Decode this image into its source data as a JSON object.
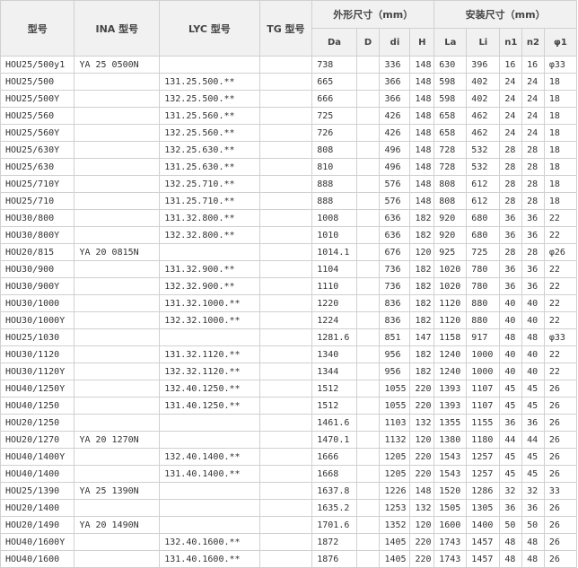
{
  "headers": {
    "model": "型号",
    "ina": "INA 型号",
    "lyc": "LYC 型号",
    "tg": "TG 型号",
    "outer_group": "外形尺寸（mm）",
    "install_group": "安装尺寸（mm）",
    "outer_cols": [
      "Da",
      "D",
      "di",
      "H"
    ],
    "install_cols": [
      "La",
      "Li",
      "n1",
      "n2",
      "φ1"
    ]
  },
  "rows": [
    [
      "HOU25/500y1",
      "YA 25 0500N",
      "",
      "",
      "738",
      "",
      "336",
      "148",
      "630",
      "396",
      "16",
      "16",
      "φ33"
    ],
    [
      "HOU25/500",
      "",
      "131.25.500.**",
      "",
      "665",
      "",
      "366",
      "148",
      "598",
      "402",
      "24",
      "24",
      "18"
    ],
    [
      "HOU25/500Y",
      "",
      "132.25.500.**",
      "",
      "666",
      "",
      "366",
      "148",
      "598",
      "402",
      "24",
      "24",
      "18"
    ],
    [
      "HOU25/560",
      "",
      "131.25.560.**",
      "",
      "725",
      "",
      "426",
      "148",
      "658",
      "462",
      "24",
      "24",
      "18"
    ],
    [
      "HOU25/560Y",
      "",
      "132.25.560.**",
      "",
      "726",
      "",
      "426",
      "148",
      "658",
      "462",
      "24",
      "24",
      "18"
    ],
    [
      "HOU25/630Y",
      "",
      "132.25.630.**",
      "",
      "808",
      "",
      "496",
      "148",
      "728",
      "532",
      "28",
      "28",
      "18"
    ],
    [
      "HOU25/630",
      "",
      "131.25.630.**",
      "",
      "810",
      "",
      "496",
      "148",
      "728",
      "532",
      "28",
      "28",
      "18"
    ],
    [
      "HOU25/710Y",
      "",
      "132.25.710.**",
      "",
      "888",
      "",
      "576",
      "148",
      "808",
      "612",
      "28",
      "28",
      "18"
    ],
    [
      "HOU25/710",
      "",
      "131.25.710.**",
      "",
      "888",
      "",
      "576",
      "148",
      "808",
      "612",
      "28",
      "28",
      "18"
    ],
    [
      "HOU30/800",
      "",
      "131.32.800.**",
      "",
      "1008",
      "",
      "636",
      "182",
      "920",
      "680",
      "36",
      "36",
      "22"
    ],
    [
      "HOU30/800Y",
      "",
      "132.32.800.**",
      "",
      "1010",
      "",
      "636",
      "182",
      "920",
      "680",
      "36",
      "36",
      "22"
    ],
    [
      "HOU20/815",
      "YA 20 0815N",
      "",
      "",
      "1014.1",
      "",
      "676",
      "120",
      "925",
      "725",
      "28",
      "28",
      "φ26"
    ],
    [
      "HOU30/900",
      "",
      "131.32.900.**",
      "",
      "1104",
      "",
      "736",
      "182",
      "1020",
      "780",
      "36",
      "36",
      "22"
    ],
    [
      "HOU30/900Y",
      "",
      "132.32.900.**",
      "",
      "1110",
      "",
      "736",
      "182",
      "1020",
      "780",
      "36",
      "36",
      "22"
    ],
    [
      "HOU30/1000",
      "",
      "131.32.1000.**",
      "",
      "1220",
      "",
      "836",
      "182",
      "1120",
      "880",
      "40",
      "40",
      "22"
    ],
    [
      "HOU30/1000Y",
      "",
      "132.32.1000.**",
      "",
      "1224",
      "",
      "836",
      "182",
      "1120",
      "880",
      "40",
      "40",
      "22"
    ],
    [
      "HOU25/1030",
      "",
      "",
      "",
      "1281.6",
      "",
      "851",
      "147",
      "1158",
      "917",
      "48",
      "48",
      "φ33"
    ],
    [
      "HOU30/1120",
      "",
      "131.32.1120.**",
      "",
      "1340",
      "",
      "956",
      "182",
      "1240",
      "1000",
      "40",
      "40",
      "22"
    ],
    [
      "HOU30/1120Y",
      "",
      "132.32.1120.**",
      "",
      "1344",
      "",
      "956",
      "182",
      "1240",
      "1000",
      "40",
      "40",
      "22"
    ],
    [
      "HOU40/1250Y",
      "",
      "132.40.1250.**",
      "",
      "1512",
      "",
      "1055",
      "220",
      "1393",
      "1107",
      "45",
      "45",
      "26"
    ],
    [
      "HOU40/1250",
      "",
      "131.40.1250.**",
      "",
      "1512",
      "",
      "1055",
      "220",
      "1393",
      "1107",
      "45",
      "45",
      "26"
    ],
    [
      "HOU20/1250",
      "",
      "",
      "",
      "1461.6",
      "",
      "1103",
      "132",
      "1355",
      "1155",
      "36",
      "36",
      "26"
    ],
    [
      "HOU20/1270",
      "YA 20 1270N",
      "",
      "",
      "1470.1",
      "",
      "1132",
      "120",
      "1380",
      "1180",
      "44",
      "44",
      "26"
    ],
    [
      "HOU40/1400Y",
      "",
      "132.40.1400.**",
      "",
      "1666",
      "",
      "1205",
      "220",
      "1543",
      "1257",
      "45",
      "45",
      "26"
    ],
    [
      "HOU40/1400",
      "",
      "131.40.1400.**",
      "",
      "1668",
      "",
      "1205",
      "220",
      "1543",
      "1257",
      "45",
      "45",
      "26"
    ],
    [
      "HOU25/1390",
      "YA 25 1390N",
      "",
      "",
      "1637.8",
      "",
      "1226",
      "148",
      "1520",
      "1286",
      "32",
      "32",
      "33"
    ],
    [
      "HOU20/1400",
      "",
      "",
      "",
      "1635.2",
      "",
      "1253",
      "132",
      "1505",
      "1305",
      "36",
      "36",
      "26"
    ],
    [
      "HOU20/1490",
      "YA 20 1490N",
      "",
      "",
      "1701.6",
      "",
      "1352",
      "120",
      "1600",
      "1400",
      "50",
      "50",
      "26"
    ],
    [
      "HOU40/1600Y",
      "",
      "132.40.1600.**",
      "",
      "1872",
      "",
      "1405",
      "220",
      "1743",
      "1457",
      "48",
      "48",
      "26"
    ],
    [
      "HOU40/1600",
      "",
      "131.40.1600.**",
      "",
      "1876",
      "",
      "1405",
      "220",
      "1743",
      "1457",
      "48",
      "48",
      "26"
    ]
  ]
}
